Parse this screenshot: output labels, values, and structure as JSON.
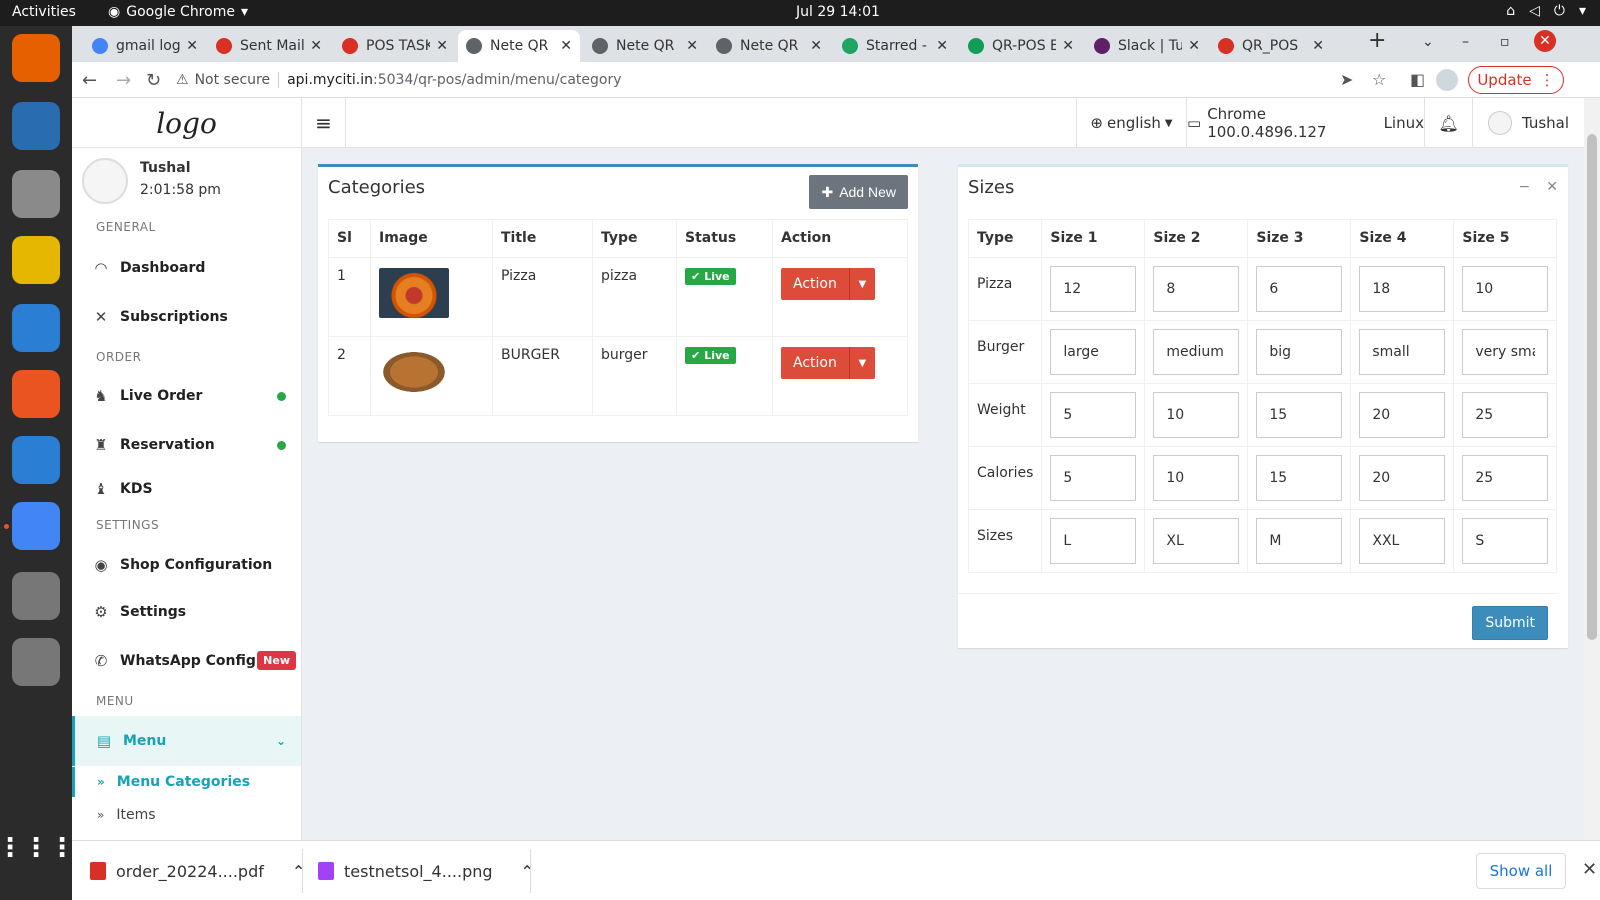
{
  "os": {
    "activities": "Activities",
    "app_name": "Google Chrome",
    "clock": "Jul 29  14:01"
  },
  "dock": {
    "apps": [
      {
        "name": "firefox-icon",
        "color": "#e66000"
      },
      {
        "name": "thunderbird-icon",
        "color": "#2a6cb0"
      },
      {
        "name": "files-icon",
        "color": "#8a8a8a"
      },
      {
        "name": "rhythmbox-icon",
        "color": "#e5b700"
      },
      {
        "name": "writer-icon",
        "color": "#2a7fd4"
      },
      {
        "name": "software-icon",
        "color": "#e95420"
      },
      {
        "name": "help-icon",
        "color": "#2a7fd4"
      },
      {
        "name": "chrome-icon",
        "color": "#4285f4"
      },
      {
        "name": "disc-icon",
        "color": "#777777"
      },
      {
        "name": "disc-icon-2",
        "color": "#777777"
      }
    ]
  },
  "browser": {
    "tabs": [
      {
        "title": "gmail log",
        "fav_color": "#4285f4",
        "active": false
      },
      {
        "title": "Sent Mail",
        "fav_color": "#d93025",
        "active": false
      },
      {
        "title": "POS TASK",
        "fav_color": "#d93025",
        "active": false
      },
      {
        "title": "Nete QR |",
        "fav_color": "#5f6368",
        "active": true
      },
      {
        "title": "Nete QR |",
        "fav_color": "#5f6368",
        "active": false
      },
      {
        "title": "Nete QR |",
        "fav_color": "#5f6368",
        "active": false
      },
      {
        "title": "Starred -",
        "fav_color": "#1fa463",
        "active": false
      },
      {
        "title": "QR-POS E",
        "fav_color": "#0f9d58",
        "active": false
      },
      {
        "title": "Slack | Tu",
        "fav_color": "#611f69",
        "active": false
      },
      {
        "title": "QR_POS",
        "fav_color": "#d93025",
        "active": false
      }
    ],
    "not_secure": "Not secure",
    "url_host": "api.myciti.in",
    "url_path": ":5034/qr-pos/admin/menu/category",
    "update_label": "Update"
  },
  "header": {
    "logo": "logo",
    "language": "english",
    "browser_info": "Chrome 100.0.4896.127",
    "os_info": "Linux",
    "username": "Tushal"
  },
  "sidebar": {
    "user_name": "Tushal",
    "user_time": "2:01:58 pm",
    "sections": {
      "general": "GENERAL",
      "order": "ORDER",
      "settings": "SETTINGS",
      "menu": "MENU"
    },
    "items": {
      "dashboard": "Dashboard",
      "subscriptions": "Subscriptions",
      "live_order": "Live Order",
      "reservation": "Reservation",
      "kds": "KDS",
      "shop_configuration": "Shop Configuration",
      "settings": "Settings",
      "whatsapp_config": "WhatsApp Config",
      "whatsapp_badge": "New",
      "menu": "Menu",
      "menu_categories": "Menu Categories",
      "items": "Items"
    }
  },
  "categories": {
    "title": "Categories",
    "add_new": "Add New",
    "columns": [
      "Sl",
      "Image",
      "Title",
      "Type",
      "Status",
      "Action"
    ],
    "rows": [
      {
        "sl": "1",
        "image": "pizza",
        "title": "Pizza",
        "type": "pizza",
        "status": "Live",
        "action": "Action"
      },
      {
        "sl": "2",
        "image": "burger",
        "title": "BURGER",
        "type": "burger",
        "status": "Live",
        "action": "Action"
      }
    ]
  },
  "sizes": {
    "title": "Sizes",
    "columns": [
      "Type",
      "Size 1",
      "Size 2",
      "Size 3",
      "Size 4",
      "Size 5"
    ],
    "rows": [
      {
        "type": "Pizza",
        "values": [
          "12",
          "8",
          "6",
          "18",
          "10"
        ]
      },
      {
        "type": "Burger",
        "values": [
          "large",
          "medium",
          "big",
          "small",
          "very small"
        ]
      },
      {
        "type": "Weight",
        "values": [
          "5",
          "10",
          "15",
          "20",
          "25"
        ]
      },
      {
        "type": "Calories",
        "values": [
          "5",
          "10",
          "15",
          "20",
          "25"
        ]
      },
      {
        "type": "Sizes",
        "values": [
          "L",
          "XL",
          "M",
          "XXL",
          "S"
        ]
      }
    ],
    "submit": "Submit"
  },
  "downloads": {
    "items": [
      {
        "name": "order_20224....pdf",
        "color": "#d93025"
      },
      {
        "name": "testnetsol_4....png",
        "color": "#a142f4"
      }
    ],
    "show_all": "Show all"
  }
}
